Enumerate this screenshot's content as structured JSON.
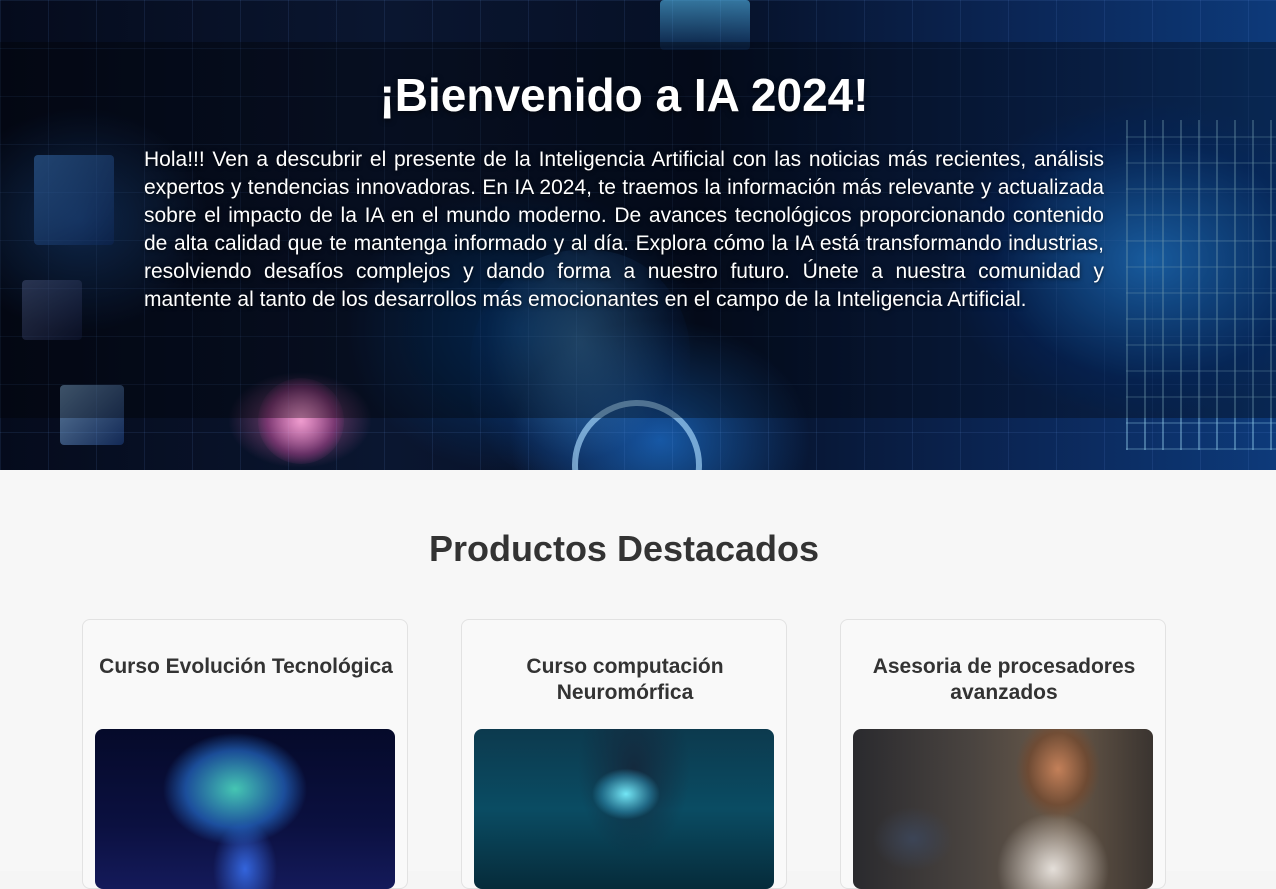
{
  "hero": {
    "title": "¡Bienvenido a IA 2024!",
    "text": "Hola!!! Ven a descubrir el presente de la Inteligencia Artificial con las noticias más recientes, análisis expertos y tendencias innovadoras. En IA 2024, te traemos la información más relevante y actualizada sobre el impacto de la IA en el mundo moderno. De avances tecnológicos proporcionando contenido de alta calidad que te mantenga informado y al día. Explora cómo la IA está transformando industrias, resolviendo desafíos complejos y dando forma a nuestro futuro. Únete a nuestra comunidad y mantente al tanto de los desarrollos más emocionantes en el campo de la Inteligencia Artificial."
  },
  "products": {
    "title": "Productos Destacados",
    "items": [
      {
        "title": "Curso Evolución Tecnológica",
        "image": "brain-hologram-image"
      },
      {
        "title": "Curso computación Neuromórfica",
        "image": "businessman-digital-brain-image"
      },
      {
        "title": "Asesoria de procesadores avanzados",
        "image": "woman-with-tablet-image"
      }
    ]
  },
  "colors": {
    "heading": "#333333",
    "background": "#f7f7f7",
    "card_border": "#e2e2e2",
    "hero_text": "#ffffff"
  }
}
